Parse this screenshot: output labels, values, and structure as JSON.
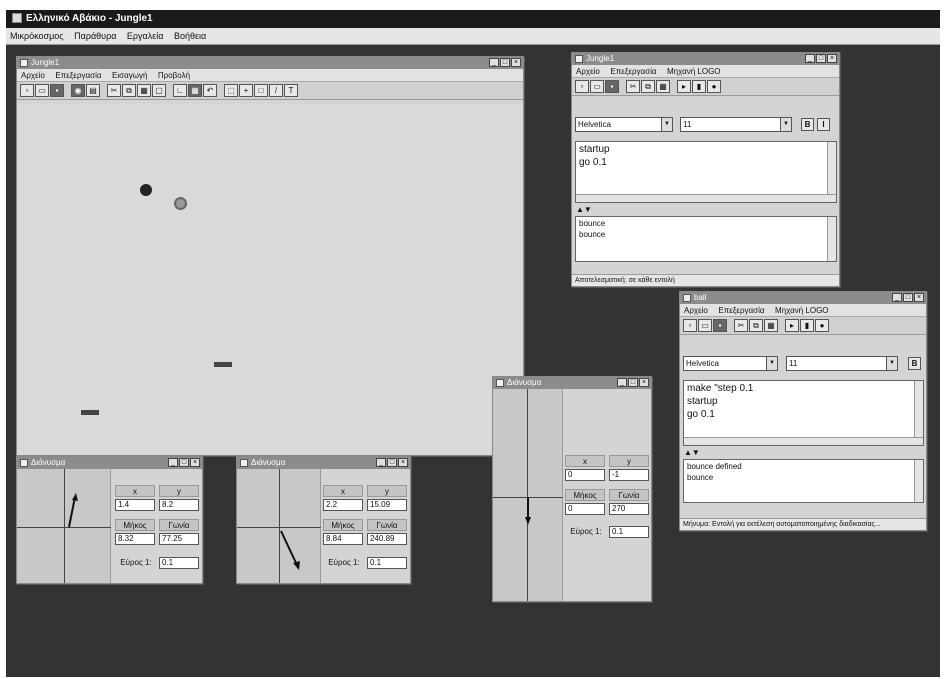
{
  "app": {
    "title": "Ελληνικό Αβάκιο - Jungle1",
    "menu": [
      "Μικρόκοσμος",
      "Παράθυρα",
      "Εργαλεία",
      "Βοήθεια"
    ]
  },
  "canvas_window": {
    "title": "Jungle1",
    "menu": [
      "Αρχείο",
      "Επεξεργασία",
      "Εισαγωγή",
      "Προβολή"
    ]
  },
  "logo_window_1": {
    "title": "Jungle1",
    "menu": [
      "Αρχείο",
      "Επεξεργασία",
      "Μηχανή LOGO"
    ],
    "font": "Helvetica",
    "size": "11",
    "code_lines": [
      "startup",
      "go 0.1"
    ],
    "output_lines": [
      "bounce",
      "bounce"
    ],
    "status": "Αποτελεσματική: σε κάθε εντολή"
  },
  "logo_window_2": {
    "title": "ball",
    "menu": [
      "Αρχείο",
      "Επεξεργασία",
      "Μηχανή LOGO"
    ],
    "font": "Helvetica",
    "size": "11",
    "code_lines": [
      "make \"step 0.1",
      "startup",
      "go 0.1"
    ],
    "output_lines": [
      "bounce defined",
      "bounce"
    ],
    "status": "Μήνυμα: Εντολή για εκτέλεση αυτοματοποιημένης διαδικασίας..."
  },
  "vector_1": {
    "title": "Διάνυσμα",
    "x_label": "x",
    "y_label": "y",
    "x": "1.4",
    "y": "8.2",
    "length_label": "Μήκος",
    "angle_label": "Γωνία",
    "length": "8.32",
    "angle": "77.25",
    "scale_label": "Εύρος 1:",
    "scale": "0.1"
  },
  "vector_2": {
    "title": "Διάνυσμα",
    "x_label": "x",
    "y_label": "y",
    "x": "2.2",
    "y": "15.09",
    "length_label": "Μήκος",
    "angle_label": "Γωνία",
    "length": "8.84",
    "angle": "240.89",
    "scale_label": "Εύρος 1:",
    "scale": "0.1"
  },
  "vector_3": {
    "title": "Διάνυσμα",
    "x_label": "x",
    "y_label": "y",
    "x": "0",
    "y": "-1",
    "length_label": "Μήκος",
    "angle_label": "Γωνία",
    "length": "0",
    "angle": "270",
    "scale_label": "Εύρος 1:",
    "scale": "0.1"
  }
}
